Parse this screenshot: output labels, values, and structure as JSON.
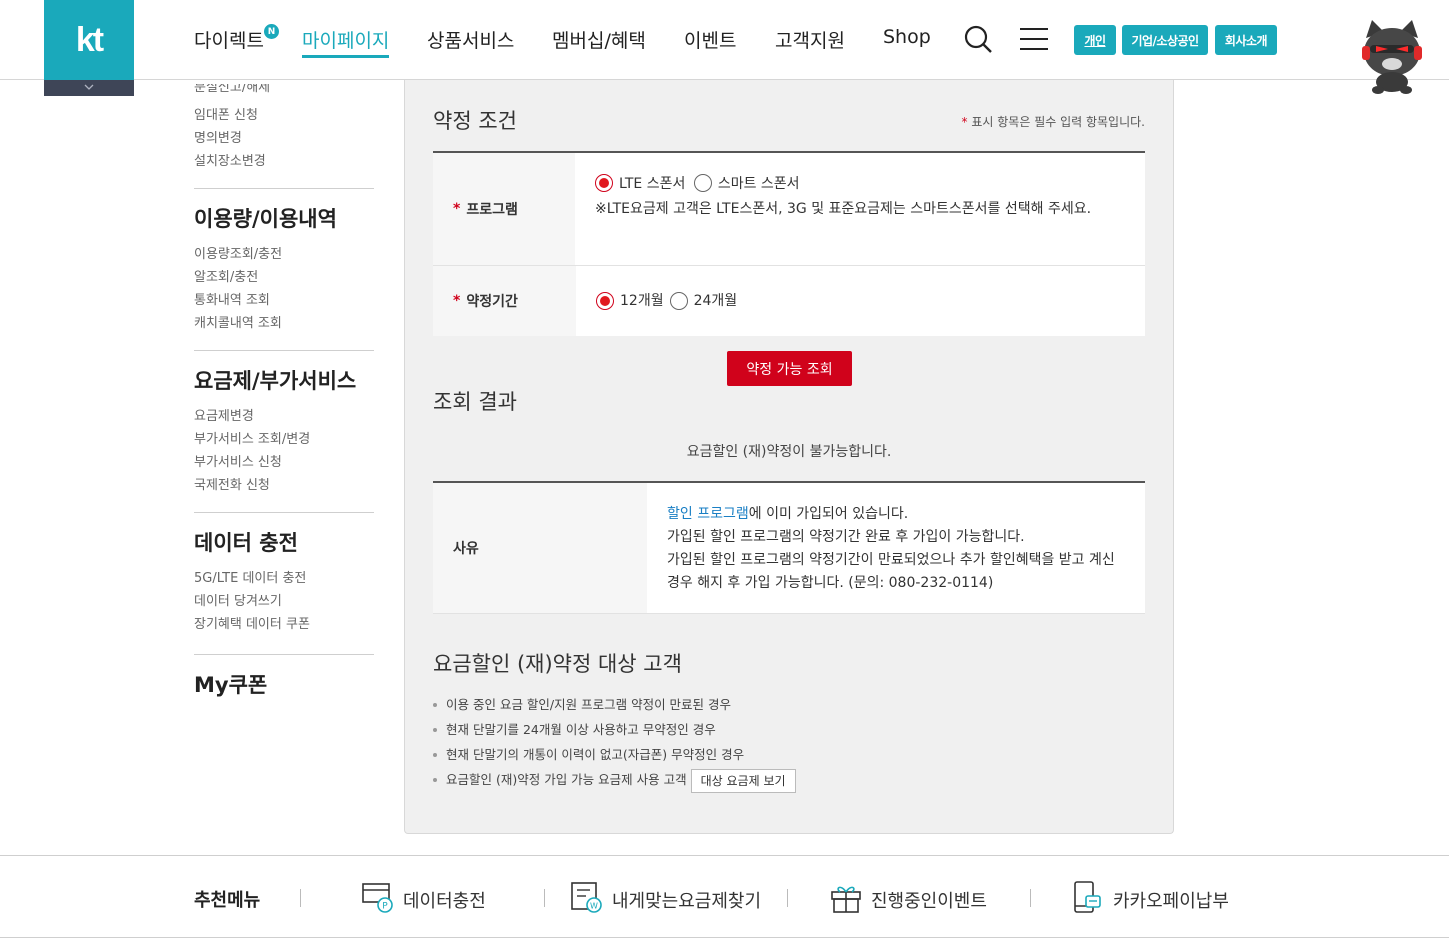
{
  "header": {
    "logo": "kt",
    "nav": [
      {
        "label": "다이렉트",
        "badge": "N"
      },
      {
        "label": "마이페이지",
        "active": true
      },
      {
        "label": "상품서비스"
      },
      {
        "label": "멤버십/혜택"
      },
      {
        "label": "이벤트"
      },
      {
        "label": "고객지원"
      },
      {
        "label": "Shop"
      }
    ],
    "segments": [
      "개인",
      "기업/소상공인",
      "회사소개"
    ],
    "accent_color": "#1aa9bb"
  },
  "sidebar": {
    "top_items": [
      "분실신고/해제",
      "임대폰 신청",
      "명의변경",
      "설치장소변경"
    ],
    "sections": [
      {
        "title": "이용량/이용내역",
        "items": [
          "이용량조회/충전",
          "알조회/충전",
          "통화내역 조회",
          "캐치콜내역 조회"
        ]
      },
      {
        "title": "요금제/부가서비스",
        "items": [
          "요금제변경",
          "부가서비스 조회/변경",
          "부가서비스 신청",
          "국제전화 신청"
        ]
      },
      {
        "title": "데이터 충전",
        "items": [
          "5G/LTE 데이터 충전",
          "데이터 당겨쓰기",
          "장기혜택 데이터 쿠폰"
        ]
      },
      {
        "title": "My쿠폰",
        "items": []
      }
    ]
  },
  "main": {
    "condition_title": "약정 조건",
    "required_note": "표시 항목은 필수 입력 항목입니다.",
    "required_star": "*",
    "program": {
      "label": "프로그램",
      "options": [
        "LTE 스폰서",
        "스마트 스폰서"
      ],
      "selected": "LTE 스폰서",
      "note": "※LTE요금제 고객은 LTE스폰서, 3G 및 표준요금제는 스마트스폰서를 선택해 주세요."
    },
    "period": {
      "label": "약정기간",
      "options": [
        "12개월",
        "24개월"
      ],
      "selected": "12개월"
    },
    "query_button": "약정 가능 조회",
    "result_title": "조회 결과",
    "result_message": "요금할인 (재)약정이 불가능합니다.",
    "reason": {
      "label": "사유",
      "link_text": "할인 프로그램",
      "line1_rest": "에 이미 가입되어 있습니다.",
      "line2": "가입된 할인 프로그램의 약정기간 완료 후 가입이 가능합니다.",
      "line3": "가입된 할인 프로그램의 약정기간이 만료되었으나 추가 할인혜택을 받고 계신 경우 해지 후 가입 가능합니다. (문의: 080-232-0114)"
    },
    "target_title": "요금할인 (재)약정 대상 고객",
    "target_items": [
      "이용 중인 요금 할인/지원 프로그램 약정이 만료된 경우",
      "현재 단말기를 24개월 이상 사용하고 무약정인 경우",
      "현재 단말기의 개통이 이력이 없고(자급폰) 무약정인 경우",
      "요금할인 (재)약정 가입 가능 요금제 사용 고객"
    ],
    "target_button": "대상 요금제 보기"
  },
  "recommend": {
    "title": "추천메뉴",
    "items": [
      {
        "label": "데이터충전",
        "icon": "data-charge-icon"
      },
      {
        "label": "내게맞는요금제찾기",
        "icon": "plan-finder-icon"
      },
      {
        "label": "진행중인이벤트",
        "icon": "gift-icon"
      },
      {
        "label": "카카오페이납부",
        "icon": "kakaopay-icon"
      }
    ]
  },
  "colors": {
    "brand": "#1aa9bb",
    "primary_red": "#d0021b",
    "link": "#1a7fc4"
  }
}
